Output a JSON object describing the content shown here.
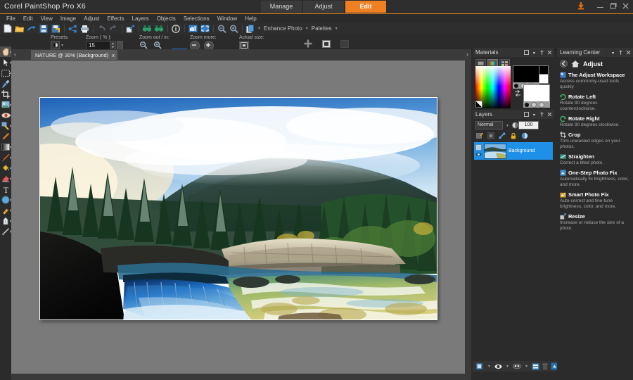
{
  "app": {
    "title": "Corel PaintShop Pro X6",
    "accent_color": "#ef8022",
    "window_buttons": [
      "minimize",
      "restore",
      "close"
    ]
  },
  "workspace_tabs": [
    {
      "label": "Manage",
      "active": false
    },
    {
      "label": "Adjust",
      "active": false
    },
    {
      "label": "Edit",
      "active": true
    }
  ],
  "menubar": {
    "items": [
      "File",
      "Edit",
      "View",
      "Image",
      "Adjust",
      "Effects",
      "Layers",
      "Objects",
      "Selections",
      "Window",
      "Help"
    ]
  },
  "toolbar": {
    "icons": [
      "new-document-icon",
      "open-folder-icon",
      "import-icon",
      "save-icon",
      "save-as-icon",
      "share-icon",
      "print-icon",
      "undo-icon",
      "redo-icon",
      "resize-icon",
      "binoculars-before-icon",
      "binoculars-after-icon",
      "info-icon",
      "histogram-icon",
      "fullscreen-icon",
      "zoom-out-icon",
      "zoom-in-icon",
      "duplicate-icon"
    ],
    "menus": [
      "Enhance Photo",
      "Palettes"
    ]
  },
  "options_bar": {
    "presets_label": "Presets:",
    "zoom_label": "Zoom ( % ):",
    "zoom_value": "15",
    "zoom_out_in_label": "Zoom out / in:",
    "zoom_more_label": "Zoom more:",
    "actual_size_label": "Actual size:"
  },
  "tools": [
    {
      "name": "pan-tool",
      "selected": true
    },
    {
      "name": "pick-tool",
      "selected": false
    },
    {
      "name": "selection-tool",
      "selected": false
    },
    {
      "name": "dropper-tool",
      "selected": false
    },
    {
      "name": "crop-tool",
      "selected": false
    },
    {
      "name": "makeover-tool",
      "selected": false
    },
    {
      "name": "red-eye-tool",
      "selected": false
    },
    {
      "name": "clone-brush-tool",
      "selected": false
    },
    {
      "name": "scratch-remover-tool",
      "selected": false
    },
    {
      "name": "gradient-tool",
      "selected": false
    },
    {
      "name": "paint-brush-tool",
      "selected": false
    },
    {
      "name": "flood-fill-tool",
      "selected": false
    },
    {
      "name": "eraser-tool",
      "selected": false
    },
    {
      "name": "text-tool",
      "selected": false
    },
    {
      "name": "shape-tool",
      "selected": false
    },
    {
      "name": "smudge-tool",
      "selected": false
    },
    {
      "name": "pen-tool",
      "selected": false
    },
    {
      "name": "warp-brush-tool",
      "selected": false
    }
  ],
  "document": {
    "tab_label": "NATURE @ 30% (Background)",
    "close_label": "x",
    "prev_arrow": "‹",
    "next_arrow": "›"
  },
  "materials": {
    "title": "Materials",
    "tabs": [
      "frame-tab",
      "rainbow-tab",
      "swatches-tab"
    ],
    "foreground_color": "#000000",
    "background_color": "#ffffff"
  },
  "layers": {
    "title": "Layers",
    "blend_mode": "Normal",
    "opacity": "100",
    "rows": [
      {
        "name": "Background",
        "selected": true
      }
    ],
    "toolbar_icons": [
      "new-raster-layer-icon",
      "new-mask-layer-icon",
      "link-icon",
      "lock-icon",
      "new-adjustment-layer-icon"
    ],
    "bottom_icons": [
      "new-layer-icon",
      "new-mask-icon",
      "layer-group-icon",
      "layer-properties-icon",
      "delete-layer-icon",
      "merge-icon"
    ]
  },
  "learning_center": {
    "title": "Learning Center",
    "back_icon": "back-arrow-icon",
    "home_icon": "home-icon",
    "section_title": "Adjust",
    "items": [
      {
        "icon": "workspace-icon",
        "name": "The Adjust Workspace",
        "desc": "Access commonly-used tools quickly"
      },
      {
        "icon": "rotate-left-icon",
        "name": "Rotate Left",
        "desc": "Rotate 90 degrees counterclockwise."
      },
      {
        "icon": "rotate-right-icon",
        "name": "Rotate Right",
        "desc": "Rotate 90 degrees clockwise."
      },
      {
        "icon": "crop-icon",
        "name": "Crop",
        "desc": "Trim unwanted edges on your photos."
      },
      {
        "icon": "straighten-icon",
        "name": "Straighten",
        "desc": "Correct a tilted photo."
      },
      {
        "icon": "one-step-fix-icon",
        "name": "One-Step Photo Fix",
        "desc": "Automatically fix brightness, color, and more."
      },
      {
        "icon": "smart-fix-icon",
        "name": "Smart Photo Fix",
        "desc": "Auto-correct and fine-tune brightness, color, and more."
      },
      {
        "icon": "resize-icon",
        "name": "Resize",
        "desc": "Increase or reduce the size of a photo."
      }
    ]
  },
  "photo": {
    "name": "nature-landscape-waterfall",
    "description": "Mountain landscape with misty peak, evergreen forest, limestone cliffs and a silky blue waterfall flowing into a golden-green river"
  }
}
